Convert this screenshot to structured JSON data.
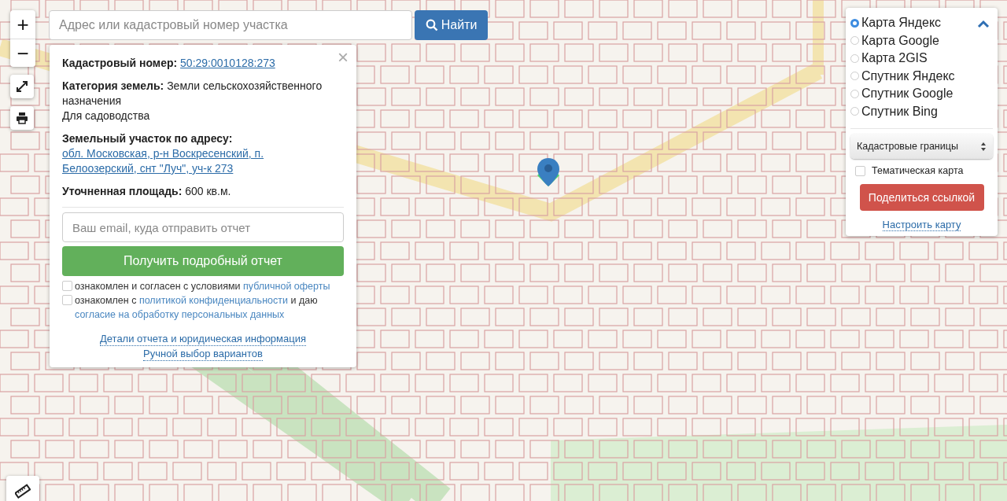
{
  "map_controls": {
    "zoom_in": "+",
    "zoom_out": "−"
  },
  "search": {
    "placeholder": "Адрес или кадастровый номер участка",
    "button": "Найти"
  },
  "info_panel": {
    "close": "×",
    "fields": [
      {
        "kind": "link",
        "label": "Кадастровый номер:",
        "value": "50:29:0010128:273"
      },
      {
        "kind": "text",
        "label": "Категория земель:",
        "value": "Земли сельскохозяйственного назначения",
        "note": "Для садоводства"
      },
      {
        "kind": "link",
        "label": "Земельный участок по адресу:",
        "value": "обл. Московская, р-н Воскресенский, п. Белоозерский, снт \"Луч\", уч-к 273"
      },
      {
        "kind": "text",
        "label": "Уточненная площадь:",
        "value": "600 кв.м."
      }
    ],
    "email": {
      "placeholder": "Ваш email, куда отправить отчет"
    },
    "button": "Получить подробный отчет",
    "consents": [
      {
        "checked": false,
        "parts": [
          {
            "kind": "text",
            "text": "ознакомлен и согласен с условиями "
          },
          {
            "kind": "link",
            "text": "публичной оферты"
          }
        ]
      },
      {
        "checked": false,
        "parts": [
          {
            "kind": "text",
            "text": "ознакомлен с "
          },
          {
            "kind": "link",
            "text": "политикой конфиденциальности"
          },
          {
            "kind": "text",
            "text": " и даю "
          },
          {
            "kind": "link",
            "text": "согласие на обработку персональных данных"
          }
        ]
      }
    ],
    "footer_links": [
      "Детали отчета и юридическая информация",
      "Ручной выбор вариантов"
    ]
  },
  "layers_panel": {
    "expanded": true,
    "options": [
      {
        "label": "Карта Яндекс",
        "selected": true
      },
      {
        "label": "Карта Google",
        "selected": false
      },
      {
        "label": "Карта 2GIS",
        "selected": false
      },
      {
        "label": "Спутник Яндекс",
        "selected": false
      },
      {
        "label": "Спутник Google",
        "selected": false
      },
      {
        "label": "Спутник Bing",
        "selected": false
      }
    ],
    "overlay_select": "Кадастровые границы",
    "thematic": {
      "label": "Тематическая карта",
      "checked": false
    },
    "share_button": "Поделиться ссылкой",
    "settings_link": "Настроить карту"
  }
}
